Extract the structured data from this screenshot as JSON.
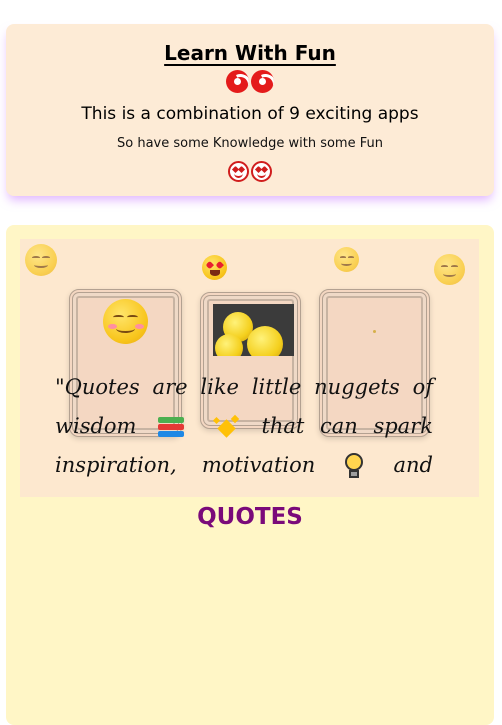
{
  "header": {
    "title": "Learn With Fun",
    "subtitle": "This is a combination of 9 exciting apps",
    "tagline": "So have some Knowledge with some Fun",
    "title_icons": [
      "cyclone-icon",
      "cyclone-icon"
    ],
    "tagline_icons": [
      "heart-eyes-icon",
      "heart-eyes-icon"
    ]
  },
  "quotes": {
    "title": "QUOTES",
    "text_parts": [
      "\"Quotes are like little nuggets of wisdom",
      "that can spark inspiration,",
      "motivation",
      "and"
    ]
  },
  "colors": {
    "header_bg": "#fdebd6",
    "quotes_bg": "#fff6c6",
    "quotes_title": "#7a0a7a",
    "header_shadow": "#c878ff"
  }
}
